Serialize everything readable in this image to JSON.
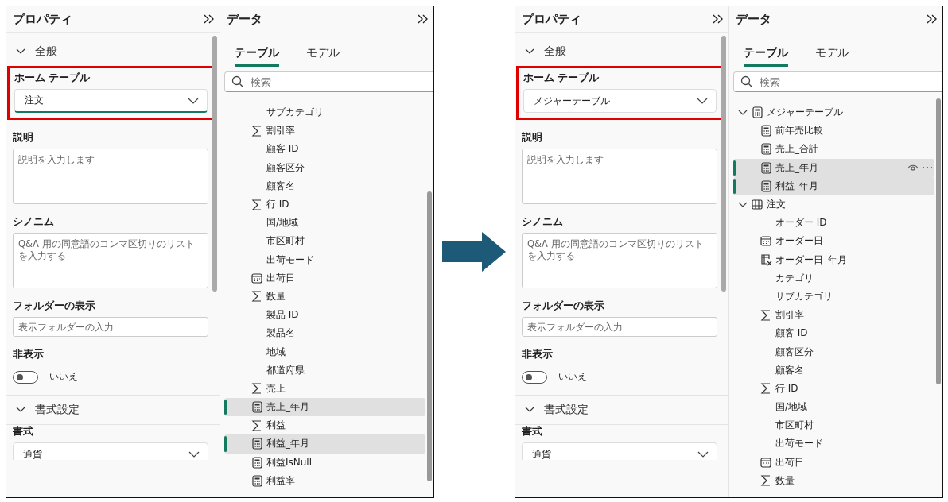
{
  "screens": [
    {
      "properties": {
        "title": "プロパティ",
        "sections": [
          {
            "title": "全般",
            "expanded": true,
            "fields": [
              {
                "kind": "dropdown",
                "label": "ホーム テーブル",
                "value": "注文",
                "highlighted": true,
                "focused": true
              },
              {
                "kind": "textarea",
                "label": "説明",
                "placeholder": "説明を入力します"
              },
              {
                "kind": "textarea",
                "label": "シノニム",
                "placeholder": "Q&A 用の同意語のコンマ区切りのリストを入力する"
              },
              {
                "kind": "input",
                "label": "フォルダーの表示",
                "placeholder": "表示フォルダーの入力"
              },
              {
                "kind": "toggle",
                "label": "非表示",
                "on": false,
                "text": "いいえ"
              }
            ]
          },
          {
            "title": "書式設定",
            "expanded": true,
            "fields": [
              {
                "kind": "dropdown",
                "label": "書式",
                "value": "通貨",
                "focused": false
              }
            ]
          }
        ]
      },
      "data": {
        "title": "データ",
        "tabs": [
          {
            "label": "テーブル",
            "selected": true
          },
          {
            "label": "モデル",
            "selected": false
          }
        ],
        "search": {
          "placeholder": "検索"
        },
        "items": [
          {
            "kind": "plain",
            "label": "サブカテゴリ",
            "selected": false
          },
          {
            "kind": "sum",
            "label": "割引率",
            "selected": false
          },
          {
            "kind": "plain",
            "label": "顧客 ID",
            "selected": false
          },
          {
            "kind": "plain",
            "label": "顧客区分",
            "selected": false
          },
          {
            "kind": "plain",
            "label": "顧客名",
            "selected": false
          },
          {
            "kind": "sum",
            "label": "行 ID",
            "selected": false
          },
          {
            "kind": "plain",
            "label": "国/地域",
            "selected": false
          },
          {
            "kind": "plain",
            "label": "市区町村",
            "selected": false
          },
          {
            "kind": "plain",
            "label": "出荷モード",
            "selected": false
          },
          {
            "kind": "date",
            "label": "出荷日",
            "selected": false
          },
          {
            "kind": "sum",
            "label": "数量",
            "selected": false
          },
          {
            "kind": "plain",
            "label": "製品 ID",
            "selected": false
          },
          {
            "kind": "plain",
            "label": "製品名",
            "selected": false
          },
          {
            "kind": "plain",
            "label": "地域",
            "selected": false
          },
          {
            "kind": "plain",
            "label": "都道府県",
            "selected": false
          },
          {
            "kind": "sum",
            "label": "売上",
            "selected": false
          },
          {
            "kind": "measure",
            "label": "売上_年月",
            "selected": true
          },
          {
            "kind": "sum",
            "label": "利益",
            "selected": false
          },
          {
            "kind": "measure",
            "label": "利益_年月",
            "selected": true
          },
          {
            "kind": "measure",
            "label": "利益IsNull",
            "selected": false
          },
          {
            "kind": "measure",
            "label": "利益率",
            "selected": false
          }
        ]
      }
    },
    {
      "properties": {
        "title": "プロパティ",
        "sections": [
          {
            "title": "全般",
            "expanded": true,
            "fields": [
              {
                "kind": "dropdown",
                "label": "ホーム テーブル",
                "value": "メジャーテーブル",
                "highlighted": true,
                "focused": false
              },
              {
                "kind": "textarea",
                "label": "説明",
                "placeholder": "説明を入力します"
              },
              {
                "kind": "textarea",
                "label": "シノニム",
                "placeholder": "Q&A 用の同意語のコンマ区切りのリストを入力する"
              },
              {
                "kind": "input",
                "label": "フォルダーの表示",
                "placeholder": "表示フォルダーの入力"
              },
              {
                "kind": "toggle",
                "label": "非表示",
                "on": false,
                "text": "いいえ"
              }
            ]
          },
          {
            "title": "書式設定",
            "expanded": true,
            "fields": [
              {
                "kind": "dropdown",
                "label": "書式",
                "value": "通貨",
                "focused": false
              }
            ]
          }
        ]
      },
      "data": {
        "title": "データ",
        "tabs": [
          {
            "label": "テーブル",
            "selected": true
          },
          {
            "label": "モデル",
            "selected": false
          }
        ],
        "search": {
          "placeholder": "検索"
        },
        "items": [
          {
            "kind": "measure-table",
            "label": "メジャーテーブル",
            "expanded": true,
            "children": [
              {
                "kind": "measure",
                "label": "前年売比較",
                "selected": false
              },
              {
                "kind": "measure",
                "label": "売上_合計",
                "selected": false
              },
              {
                "kind": "measure",
                "label": "売上_年月",
                "selected": true,
                "hovered": true
              },
              {
                "kind": "measure",
                "label": "利益_年月",
                "selected": true
              }
            ]
          },
          {
            "kind": "table",
            "label": "注文",
            "expanded": true,
            "children": [
              {
                "kind": "plain",
                "label": "オーダー ID",
                "selected": false
              },
              {
                "kind": "date",
                "label": "オーダー日",
                "selected": false
              },
              {
                "kind": "calc-date",
                "label": "オーダー日_年月",
                "selected": false
              },
              {
                "kind": "plain",
                "label": "カテゴリ",
                "selected": false
              },
              {
                "kind": "plain",
                "label": "サブカテゴリ",
                "selected": false
              },
              {
                "kind": "sum",
                "label": "割引率",
                "selected": false
              },
              {
                "kind": "plain",
                "label": "顧客 ID",
                "selected": false
              },
              {
                "kind": "plain",
                "label": "顧客区分",
                "selected": false
              },
              {
                "kind": "plain",
                "label": "顧客名",
                "selected": false
              },
              {
                "kind": "sum",
                "label": "行 ID",
                "selected": false
              },
              {
                "kind": "plain",
                "label": "国/地域",
                "selected": false
              },
              {
                "kind": "plain",
                "label": "市区町村",
                "selected": false
              },
              {
                "kind": "plain",
                "label": "出荷モード",
                "selected": false
              },
              {
                "kind": "date",
                "label": "出荷日",
                "selected": false
              },
              {
                "kind": "sum",
                "label": "数量",
                "selected": false
              }
            ]
          }
        ]
      }
    }
  ]
}
